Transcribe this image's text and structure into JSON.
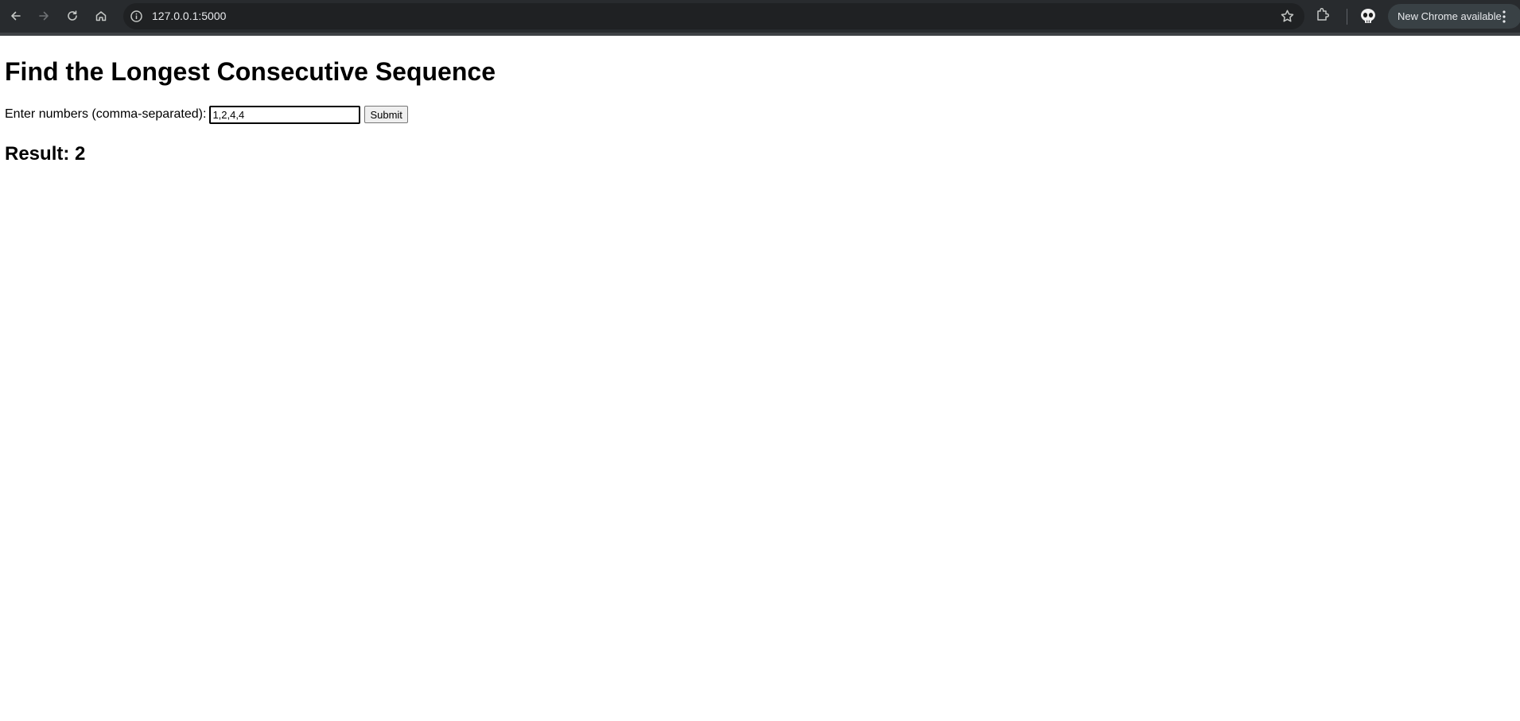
{
  "browser": {
    "url": "127.0.0.1:5000",
    "update_label": "New Chrome available",
    "icons": [
      "back-icon",
      "forward-icon",
      "reload-icon",
      "home-icon",
      "site-info-icon",
      "bookmark-star-icon",
      "extensions-icon",
      "profile-icon",
      "menu-dots-icon"
    ]
  },
  "page": {
    "title": "Find the Longest Consecutive Sequence",
    "form": {
      "label": "Enter numbers (comma-separated):",
      "input_value": "1,2,4,4",
      "submit_label": "Submit"
    },
    "result": "Result: 2"
  }
}
